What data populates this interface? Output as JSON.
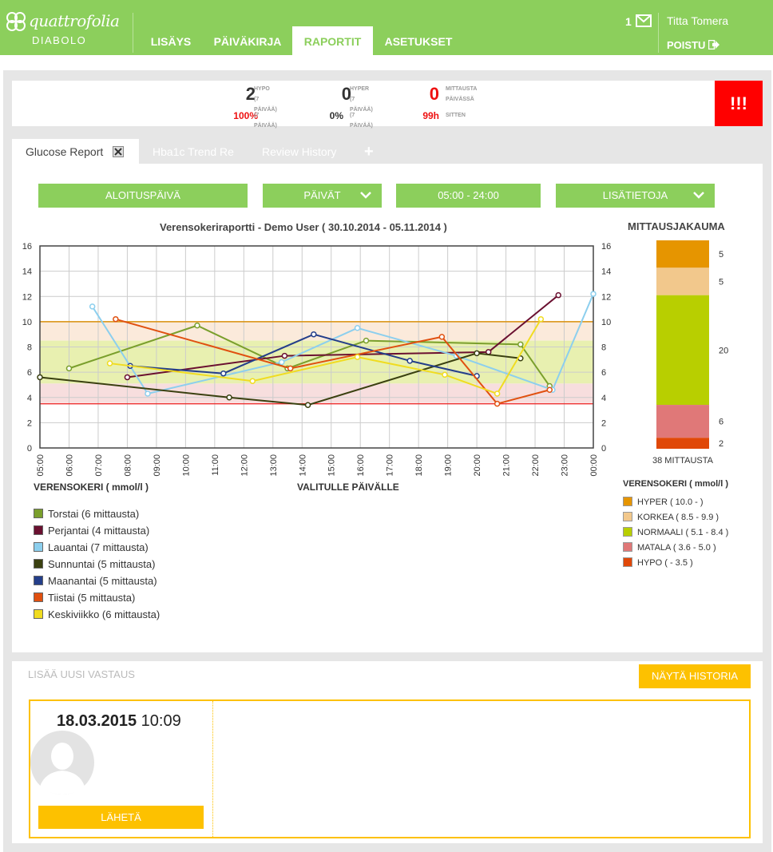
{
  "app": {
    "name": "quattrofolia",
    "sub": "DIABOLO"
  },
  "nav": [
    {
      "label": "LISÄYS",
      "active": false
    },
    {
      "label": "PÄIVÄKIRJA",
      "active": false
    },
    {
      "label": "RAPORTIT",
      "active": true
    },
    {
      "label": "ASETUKSET",
      "active": false
    }
  ],
  "header": {
    "mail_count": "1",
    "user_name": "Titta Tomera",
    "logout": "POISTU"
  },
  "stats": {
    "hypo": {
      "value": "2",
      "label1": "HYPO",
      "label2": "(7 PÄIVÄÄ)",
      "pct": "100%",
      "pct_label": "(7 PÄIVÄÄ)"
    },
    "hyper": {
      "value": "0",
      "label1": "HYPER",
      "label2": "(7 PÄIVÄÄ)",
      "pct": "0%",
      "pct_label": "(7 PÄIVÄÄ)"
    },
    "measure": {
      "value": "0",
      "label1": "MITTAUSTA",
      "label2": "PÄIVÄSSÄ",
      "pct": "99h",
      "pct_label": "SITTEN"
    },
    "alarm": "!!!"
  },
  "tabs": [
    {
      "label": "Glucose Report",
      "active": true
    },
    {
      "label": "Hba1c Trend Re",
      "active": false
    },
    {
      "label": "Review History",
      "active": false
    }
  ],
  "controls": {
    "start_date": "ALOITUSPÄIVÄ",
    "days": "PÄIVÄT",
    "time_range": "05:00 - 24:00",
    "more_info": "LISÄTIETOJA"
  },
  "colors": {
    "green": "#8ccf5c",
    "yellow": "#fdc100",
    "red": "#ff0000"
  },
  "chart_data": [
    {
      "type": "line",
      "title": "Verensokeriraportti - Demo User ( 30.10.2014 - 05.11.2014 )",
      "ylabel": "VERENSOKERI ( mmol/l )",
      "xlabel": "VALITULLE PÄIVÄLLE",
      "x_ticks": [
        "05:00",
        "06:00",
        "07:00",
        "08:00",
        "09:00",
        "10:00",
        "11:00",
        "12:00",
        "13:00",
        "14:00",
        "15:00",
        "16:00",
        "17:00",
        "18:00",
        "19:00",
        "20:00",
        "21:00",
        "22:00",
        "23:00",
        "00:00"
      ],
      "ylim": [
        0,
        16
      ],
      "y_ticks": [
        0,
        2,
        4,
        6,
        8,
        10,
        12,
        14,
        16
      ],
      "grid": true,
      "bands": [
        {
          "from": 10.0,
          "to": 16,
          "color": "#ffffff"
        },
        {
          "from": 8.5,
          "to": 10.0,
          "color": "#fbeadb"
        },
        {
          "from": 5.1,
          "to": 8.5,
          "color": "#e8f0b0"
        },
        {
          "from": 3.6,
          "to": 5.1,
          "color": "#f7dede"
        }
      ],
      "lines": [
        {
          "y": 10.0,
          "color": "#d9900b"
        },
        {
          "y": 3.5,
          "color": "#e33"
        }
      ],
      "series": [
        {
          "name": "Torstai (6 mittausta)",
          "color": "#7a9f2c",
          "x": [
            6.0,
            10.4,
            13.5,
            16.2,
            21.5,
            22.5
          ],
          "y": [
            6.3,
            9.7,
            6.3,
            8.5,
            8.2,
            4.9
          ]
        },
        {
          "name": "Perjantai (4 mittausta)",
          "color": "#6a1030",
          "x": [
            8.0,
            13.4,
            20.4,
            22.8
          ],
          "y": [
            5.6,
            7.3,
            7.6,
            12.1
          ]
        },
        {
          "name": "Lauantai (7 mittausta)",
          "color": "#8ccfee",
          "x": [
            6.8,
            8.7,
            13.3,
            15.9,
            19.3,
            22.6,
            24.0
          ],
          "y": [
            11.2,
            4.3,
            6.8,
            9.5,
            7.3,
            4.6,
            12.2
          ]
        },
        {
          "name": "Sunnuntai (5 mittausta)",
          "color": "#3a4010",
          "x": [
            5.0,
            11.5,
            14.2,
            20.0,
            21.5
          ],
          "y": [
            5.6,
            4.0,
            3.4,
            7.5,
            7.1
          ]
        },
        {
          "name": "Maanantai (5 mittausta)",
          "color": "#243e8a",
          "x": [
            8.1,
            11.3,
            14.4,
            17.7,
            20.0
          ],
          "y": [
            6.5,
            5.9,
            9.0,
            6.9,
            5.7
          ]
        },
        {
          "name": "Tiistai (5 mittausta)",
          "color": "#e05010",
          "x": [
            7.6,
            13.6,
            18.8,
            20.7,
            22.5
          ],
          "y": [
            10.2,
            6.3,
            8.8,
            3.5,
            4.6
          ]
        },
        {
          "name": "Keskiviikko (6 mittausta)",
          "color": "#f0dc20",
          "x": [
            7.4,
            12.3,
            15.9,
            18.9,
            20.7,
            22.2
          ],
          "y": [
            6.7,
            5.3,
            7.2,
            5.8,
            4.3,
            10.2
          ]
        }
      ]
    },
    {
      "type": "bar",
      "title": "MITTAUSJAKAUMA",
      "total_label": "38 MITTAUSTA",
      "legend_title": "VERENSOKERI ( mmol/l )",
      "categories": [
        "HYPER ( 10.0 - )",
        "KORKEA ( 8.5 - 9.9 )",
        "NORMAALI ( 5.1 - 8.4 )",
        "MATALA ( 3.6 - 5.0 )",
        "HYPO ( - 3.5 )"
      ],
      "values": [
        5,
        5,
        20,
        6,
        2
      ],
      "colors": [
        "#e69500",
        "#f2c88c",
        "#b8cf00",
        "#e07878",
        "#e04808"
      ]
    }
  ],
  "bottom": {
    "add_new": "LISÄÄ UUSI VASTAUS",
    "history_button": "NÄYTÄ HISTORIA",
    "date": "18.03.2015",
    "time": "10:09",
    "send_button": "LÄHETÄ"
  }
}
